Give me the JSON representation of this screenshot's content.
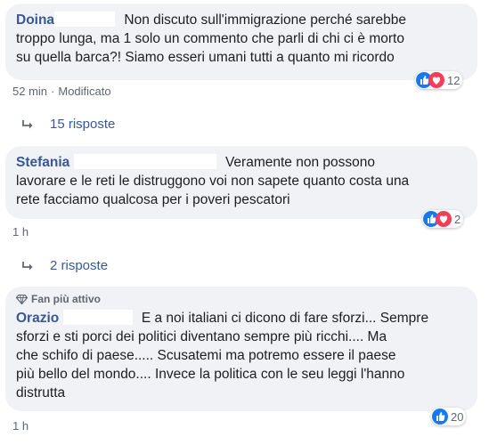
{
  "comments": [
    {
      "author": "Doina",
      "text_line1": "Non discuto sull'immigrazione perché sarebbe",
      "text_line2": "troppo lunga, ma 1 solo un commento che parli di chi ci è morto",
      "text_line3": "su quella barca?! Siamo esseri umani tutti a quanto mi ricordo",
      "time": "52 min",
      "edited": "Modificato",
      "reaction_count": "12",
      "replies": "15 risposte"
    },
    {
      "author": "Stefania",
      "text_line1": "Veramente non possono",
      "text_line2": "lavorare e le reti le distruggono voi non sapete quanto costa una",
      "text_line3": "rete facciamo qualcosa per i poveri pescatori",
      "time": "1 h",
      "reaction_count": "2",
      "replies": "2 risposte"
    },
    {
      "badge": "Fan più attivo",
      "author": "Orazio",
      "text_line1": "E a noi italiani ci dicono di fare sforzi... Sempre",
      "text_line2": "sforzi e sti porci dei politici diventano sempre più ricchi.... Ma",
      "text_line3": "che schifo di paese..... Scusatemi ma potremo essere il paese",
      "text_line4": "più bello del mondo.... Invece la politica con le seu leggi l'hanno",
      "text_line5": "distrutta",
      "time": "1 h",
      "reaction_count": "20"
    }
  ],
  "colors": {
    "link": "#385898",
    "bubble": "#f0f2f5",
    "like": "#1877f2",
    "love": "#f33e58"
  },
  "icons": [
    "like-icon",
    "love-icon",
    "reply-arrow-icon",
    "fan-diamond-icon"
  ]
}
